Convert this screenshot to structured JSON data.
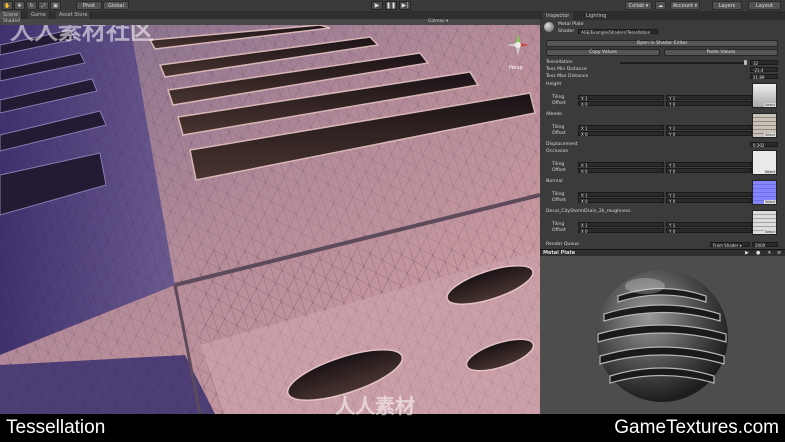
{
  "toolbar": {
    "tool_icons": [
      "hand-icon",
      "move-icon",
      "rotate-icon",
      "scale-icon",
      "rect-icon"
    ],
    "pivot_label": "Pivot",
    "global_label": "Global",
    "collab_label": "Collab ▾",
    "account_label": "Account ▾",
    "layers_label": "Layers",
    "layout_label": "Layout"
  },
  "scene_tabs": {
    "scene": "Scene",
    "game": "Game",
    "asset_store": "Asset Store",
    "shading_mode": "Shaded",
    "gizmos": "Gizmos ▾"
  },
  "viewport": {
    "view_label": "Persp",
    "watermark": "人人素材社区"
  },
  "inspector": {
    "tab_inspector": "Inspector",
    "tab_lighting": "Lighting",
    "material_name": "Metal Plate",
    "shader_label": "Shader",
    "shader_value": "AGE/Example/Shaders/Tessellation",
    "open_shader_button": "Open in Shader Editor",
    "copy_values": "Copy Values",
    "paste_values": "Paste Values",
    "tessellation": {
      "label": "Tessellation",
      "value": "32"
    },
    "tess_min": {
      "label": "Tess Min Distance",
      "value": "-21.4"
    },
    "tess_max": {
      "label": "Tess Max Distance",
      "value": "21.89"
    },
    "textures": [
      {
        "name": "Height",
        "tiling_x": "X 1",
        "tiling_y": "Y 1",
        "offset_x": "X 0",
        "offset_y": "Y 0",
        "color": "#cfcfcf",
        "select": "Select"
      },
      {
        "name": "Albedo",
        "tiling_x": "X 1",
        "tiling_y": "Y 1",
        "offset_x": "X 0",
        "offset_y": "Y 0",
        "color": "#b9b3a8",
        "select": "Select"
      },
      {
        "name": "Occlusion",
        "tiling_x": "X 1",
        "tiling_y": "Y 1",
        "offset_x": "X 0",
        "offset_y": "Y 0",
        "color": "#e8e8e8",
        "select": "Select"
      },
      {
        "name": "Normal",
        "tiling_x": "X 1",
        "tiling_y": "Y 1",
        "offset_x": "X 0",
        "offset_y": "Y 0",
        "color": "#8080ff",
        "select": "Select"
      },
      {
        "name": "Decal_CityStormDrain_2k_roughness",
        "tiling_x": "X 1",
        "tiling_y": "Y 1",
        "offset_x": "X 0",
        "offset_y": "Y 0",
        "color": "#d8d8d8",
        "select": "Select"
      }
    ],
    "tiling_label": "Tiling",
    "offset_label": "Offset",
    "displacement": {
      "label": "Displacement",
      "value": "0.202"
    },
    "render_queue": {
      "label": "Render Queue",
      "mode": "From Shader ▾",
      "value": "2000"
    }
  },
  "preview": {
    "title": "Metal Plate"
  },
  "caption": {
    "left": "Tessellation",
    "right": "GameTextures.com",
    "watermark": "人人素材"
  }
}
